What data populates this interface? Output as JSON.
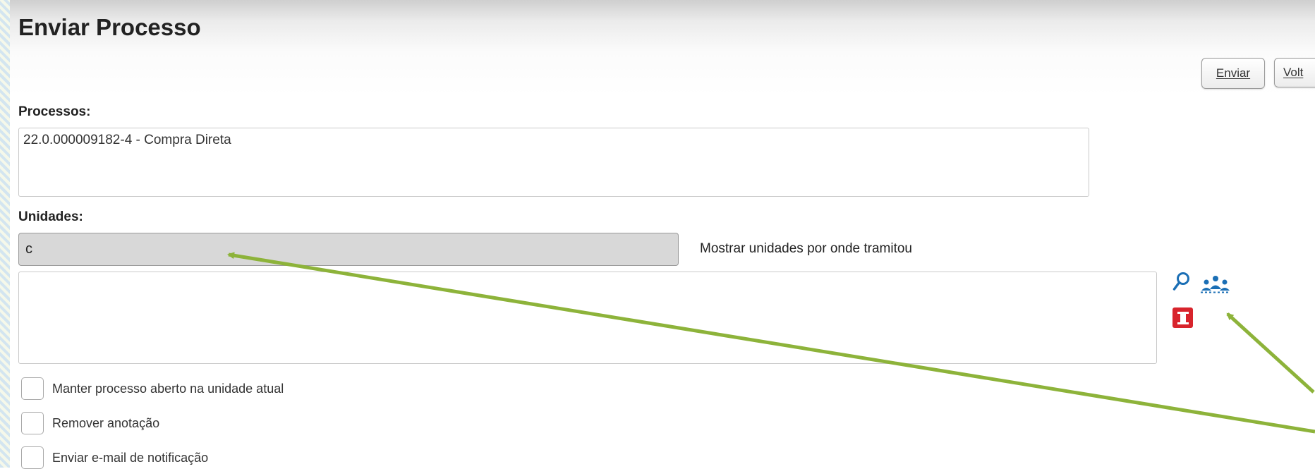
{
  "page": {
    "title": "Enviar Processo"
  },
  "toolbar": {
    "send_label": "Enviar",
    "back_label": "Volt"
  },
  "processos": {
    "label": "Processos:",
    "items": [
      "22.0.000009182-4 - Compra Direta"
    ]
  },
  "unidades": {
    "label": "Unidades:",
    "input_value": "c",
    "show_link": "Mostrar unidades por onde tramitou",
    "icons": [
      "search-icon",
      "group-icon",
      "remove-icon"
    ]
  },
  "options": [
    {
      "label": "Manter processo aberto na unidade atual",
      "checked": false
    },
    {
      "label": "Remover anotação",
      "checked": false
    },
    {
      "label": "Enviar e-mail de notificação",
      "checked": false
    }
  ],
  "colors": {
    "annotation_arrow": "#8db33a",
    "remove_icon": "#d8242c",
    "group_icon": "#1b6fb5"
  }
}
